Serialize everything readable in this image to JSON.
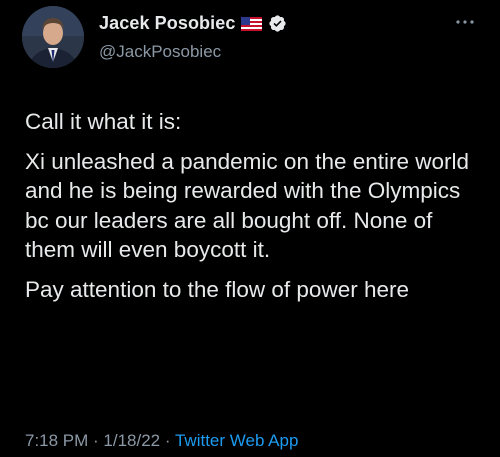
{
  "author": {
    "display_name": "Jacek Posobiec",
    "handle": "@JackPosobiec"
  },
  "icons": {
    "flag": "us-flag-icon",
    "verified": "verified-badge-icon",
    "more": "more-options-icon"
  },
  "tweet": {
    "paragraphs": [
      "Call it what it is:",
      "Xi unleashed a pandemic on the entire world and he is being rewarded with the Olympics bc our leaders are all bought off. None of them will even boycott it.",
      "Pay attention to the flow of power here"
    ],
    "time": "7:18 PM",
    "separator": " · ",
    "date": "1/18/22",
    "source": "Twitter Web App"
  },
  "colors": {
    "background": "#000000",
    "text": "#e7e9ea",
    "secondary": "#8b98a5",
    "link": "#1d9bf0"
  }
}
